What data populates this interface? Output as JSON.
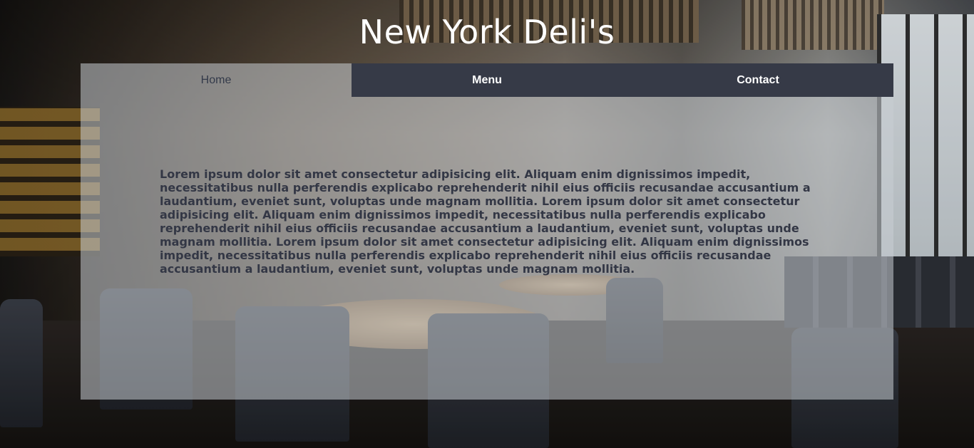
{
  "site": {
    "title": "New York Deli's"
  },
  "nav": {
    "items": [
      {
        "label": "Home",
        "active": true
      },
      {
        "label": "Menu",
        "active": false
      },
      {
        "label": "Contact",
        "active": false
      }
    ]
  },
  "main": {
    "paragraph": "Lorem ipsum dolor sit amet consectetur adipisicing elit. Aliquam enim dignissimos impedit, necessitatibus nulla perferendis explicabo reprehenderit nihil eius officiis recusandae accusantium a laudantium, eveniet sunt, voluptas unde magnam mollitia. Lorem ipsum dolor sit amet consectetur adipisicing elit. Aliquam enim dignissimos impedit, necessitatibus nulla perferendis explicabo reprehenderit nihil eius officiis recusandae accusantium a laudantium, eveniet sunt, voluptas unde magnam mollitia. Lorem ipsum dolor sit amet consectetur adipisicing elit. Aliquam enim dignissimos impedit, necessitatibus nulla perferendis explicabo reprehenderit nihil eius officiis recusandae accusantium a laudantium, eveniet sunt, voluptas unde magnam mollitia."
  },
  "colors": {
    "nav_inactive_bg": "#363a47",
    "nav_active_text": "#333a4a",
    "panel_bg": "rgba(200,205,212,0.55)",
    "body_text": "#333745"
  }
}
